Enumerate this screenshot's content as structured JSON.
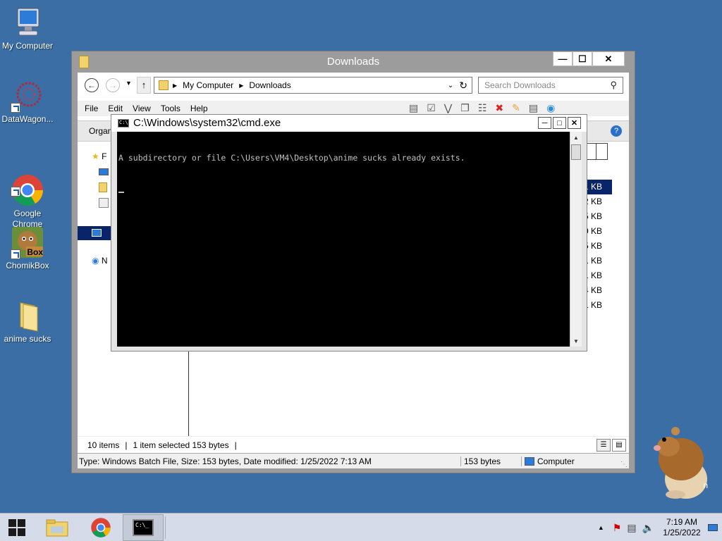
{
  "desktop": {
    "icons": [
      {
        "label": "My Computer"
      },
      {
        "label": "DataWagon..."
      },
      {
        "label": "Google\nChrome"
      },
      {
        "label": "ChomikBox"
      },
      {
        "label": "anime sucks"
      }
    ],
    "chomik_badge": "Box"
  },
  "explorer": {
    "title": "Downloads",
    "caption_buttons": {
      "minimize": "—",
      "maximize": "☐",
      "close": "✕"
    },
    "breadcrumb": [
      "My Computer",
      "Downloads"
    ],
    "search_placeholder": "Search Downloads",
    "menu": [
      "File",
      "Edit",
      "View",
      "Tools",
      "Help"
    ],
    "organize_label": "Organ",
    "nav_items": [
      "F",
      "N"
    ],
    "sizes": [
      "1 KB",
      "2 KB",
      "5 KB",
      "0 KB",
      "5 KB",
      "1 KB",
      "1 KB",
      "4 KB",
      "1 KB"
    ],
    "status": {
      "items": "10 items",
      "selected": "1 item selected  153 bytes"
    },
    "details_bar": {
      "info": "Type: Windows Batch File, Size: 153 bytes, Date modified: 1/25/2022 7:13 AM",
      "size": "153 bytes",
      "location": "Computer"
    }
  },
  "cmd": {
    "title": "C:\\Windows\\system32\\cmd.exe",
    "icon_text": "C:\\.",
    "output_line": "A subdirectory or file C:\\Users\\VM4\\Desktop\\anime sucks already exists."
  },
  "taskbar": {
    "clock_time": "7:19 AM",
    "clock_date": "1/25/2022",
    "cmd_button_text": "C:\\_"
  },
  "colors": {
    "desktop": "#3a6ea5",
    "selection": "#0a246a",
    "console_bg": "#000000",
    "console_fg": "#c0c0c0"
  },
  "mascot_text": "n"
}
